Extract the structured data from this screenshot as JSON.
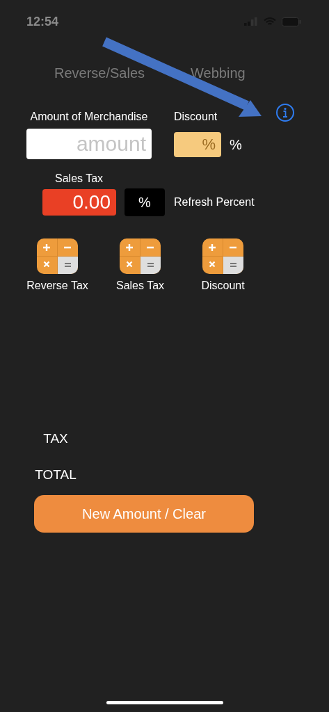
{
  "status_bar": {
    "time": "12:54"
  },
  "title": {
    "visible_parts": [
      "Reverse/Sales",
      "Webbing"
    ]
  },
  "merchandise": {
    "label": "Amount of Merchandise",
    "placeholder": "amount"
  },
  "discount": {
    "label": "Discount",
    "placeholder": "%",
    "suffix": "%"
  },
  "sales_tax": {
    "label": "Sales Tax",
    "value": "0.00",
    "percent_button": "%",
    "refresh_label": "Refresh Percent"
  },
  "calculators": [
    {
      "label": "Reverse Tax"
    },
    {
      "label": "Sales Tax"
    },
    {
      "label": "Discount"
    }
  ],
  "results": [
    {
      "label": "TAX"
    },
    {
      "label": "TOTAL"
    }
  ],
  "clear_button": "New Amount / Clear"
}
